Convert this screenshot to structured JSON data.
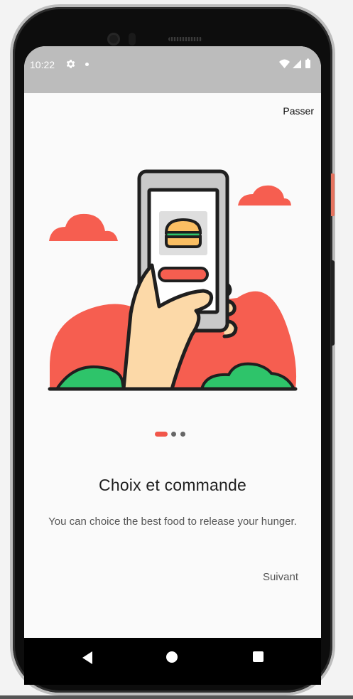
{
  "status_bar": {
    "time": "10:22"
  },
  "onboarding": {
    "skip_label": "Passer",
    "page_indicator": {
      "total": 3,
      "current": 1
    },
    "title": "Choix et commande",
    "description": "You can choice the best food to release your hunger.",
    "next_label": "Suivant"
  },
  "nav_bar": {
    "back": "back-icon",
    "home": "home-icon",
    "recents": "recents-icon"
  },
  "colors": {
    "accent": "#f1564a",
    "status_bar_bg": "#bcbcbc",
    "screen_bg": "#fafafa",
    "illustration_green": "#2ec46a",
    "illustration_skin": "#fcd9a8"
  }
}
